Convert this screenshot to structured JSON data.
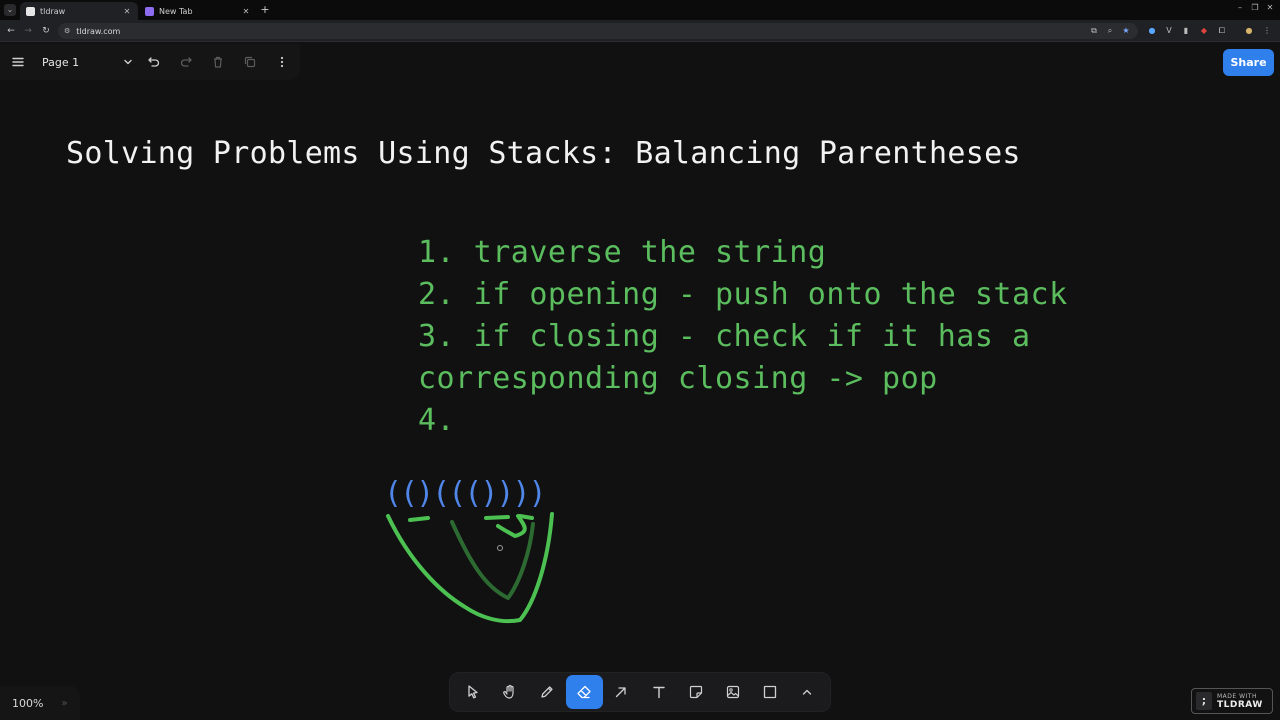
{
  "browser": {
    "tabs": [
      {
        "title": "tldraw",
        "favicon_color": "#e6e6e6",
        "active": true
      },
      {
        "title": "New Tab",
        "favicon_color": "#8e6cf0",
        "active": false
      }
    ],
    "url": "tldraw.com"
  },
  "app": {
    "page_name": "Page 1",
    "share_label": "Share",
    "zoom_label": "100%",
    "accent_color": "#2f80ed"
  },
  "canvas": {
    "heading": "Solving Problems Using Stacks: Balancing Parentheses",
    "steps": [
      "1. traverse the string",
      "2. if opening - push onto the stack",
      "3. if closing - check if it has a",
      "corresponding closing -> pop",
      "4."
    ],
    "parens": "(()((())))",
    "colors": {
      "steps": "#5bbd5e",
      "parens": "#4f86e8",
      "scribble": "#4cc152"
    }
  },
  "tools": [
    {
      "name": "select",
      "icon": "pointer-icon"
    },
    {
      "name": "hand",
      "icon": "hand-icon"
    },
    {
      "name": "draw",
      "icon": "pencil-icon"
    },
    {
      "name": "eraser",
      "icon": "eraser-icon",
      "active": true
    },
    {
      "name": "arrow",
      "icon": "arrow-icon"
    },
    {
      "name": "text",
      "icon": "text-icon"
    },
    {
      "name": "note",
      "icon": "note-icon"
    },
    {
      "name": "media",
      "icon": "image-icon"
    },
    {
      "name": "rectangle",
      "icon": "rectangle-icon"
    },
    {
      "name": "more",
      "icon": "chevron-up-icon"
    }
  ],
  "badge": {
    "line1": "MADE WITH",
    "line2": "TLDRAW"
  }
}
